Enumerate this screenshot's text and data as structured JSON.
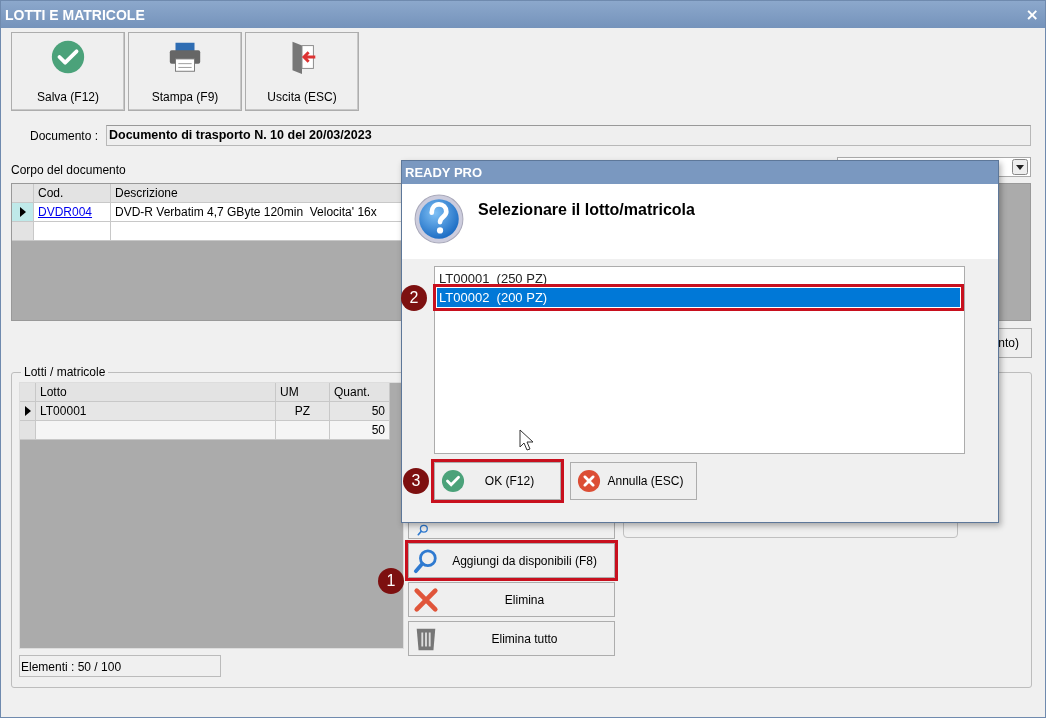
{
  "window": {
    "title": "LOTTI E MATRICOLE",
    "close": "×"
  },
  "toolbar": [
    {
      "label": "Salva (F12)",
      "kind": "save"
    },
    {
      "label": "Stampa (F9)",
      "kind": "print"
    },
    {
      "label": "Uscita (ESC)",
      "kind": "exit"
    }
  ],
  "document": {
    "label": "Documento :",
    "value": "Documento di trasporto N. 10 del 20/03/2023"
  },
  "body": {
    "title": "Corpo del documento",
    "columns": [
      "Cod.",
      "Descrizione"
    ],
    "rows": [
      {
        "code": "DVDR004",
        "description": "DVD-R Verbatim 4,7 GByte 120min  Velocita' 16x",
        "selected": true
      }
    ]
  },
  "side_button": {
    "label": "nto)"
  },
  "lots": {
    "title": "Lotti / matricole",
    "columns": [
      "Lotto",
      "UM",
      "Quant."
    ],
    "rows": [
      {
        "lot": "LT00001",
        "um": "PZ",
        "qty": "50",
        "selected": true
      }
    ],
    "total": {
      "qty": "50"
    },
    "actions": [
      {
        "kind": "history"
      },
      {
        "label": "Aggiungi da disponibili (F8)",
        "kind": "search",
        "callout": "1"
      },
      {
        "label": "Elimina",
        "kind": "delete"
      },
      {
        "label": "Elimina tutto",
        "kind": "trash"
      }
    ],
    "status": "Elementi : 50 / 100"
  },
  "dialog": {
    "title": "READY PRO",
    "message": "Selezionare il lotto/matricola",
    "items": [
      {
        "label": "LT00001  (250 PZ)",
        "selected": false
      },
      {
        "label": "LT00002  (200 PZ)",
        "selected": true,
        "callout": "2"
      }
    ],
    "buttons": [
      {
        "label": "OK (F12)",
        "kind": "ok",
        "callout": "3"
      },
      {
        "label": "Annulla (ESC)",
        "kind": "cancel"
      }
    ]
  }
}
